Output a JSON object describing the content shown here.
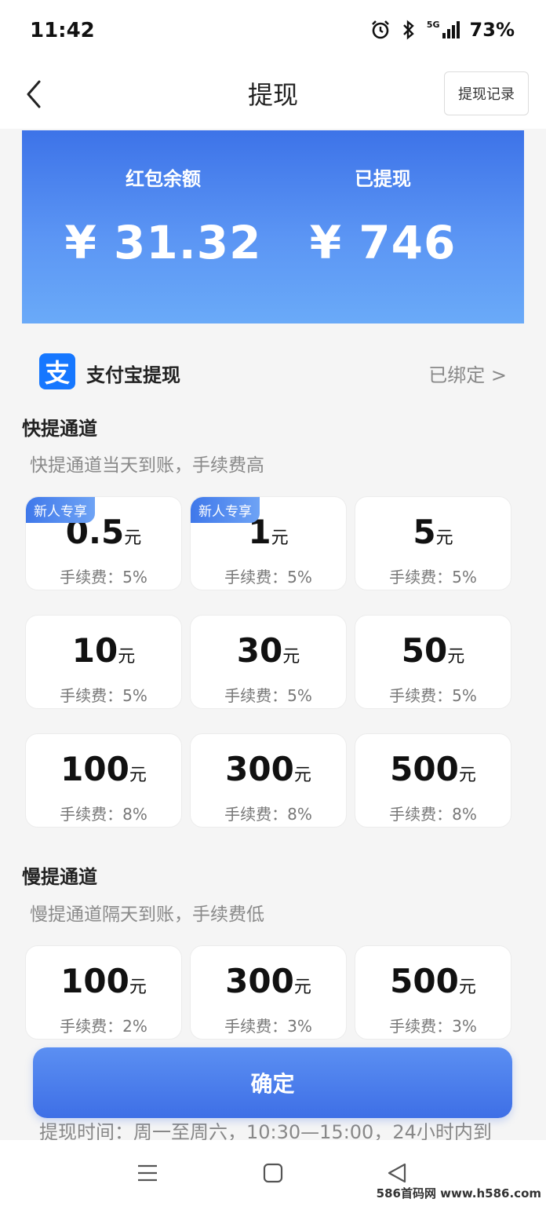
{
  "status_bar": {
    "time": "11:42",
    "network": "5G",
    "battery": "73%"
  },
  "header": {
    "title": "提现",
    "record_button": "提现记录"
  },
  "balance": {
    "left_label": "红包余额",
    "left_value": "¥ 31.32",
    "right_label": "已提现",
    "right_value": "¥ 746"
  },
  "alipay": {
    "icon_char": "支",
    "label": "支付宝提现",
    "bound": "已绑定 >"
  },
  "fast": {
    "title": "快提通道",
    "subtitle": "快提通道当天到账，手续费高",
    "cards": [
      {
        "amount": "0.5",
        "unit": "元",
        "fee": "手续费：5%",
        "badge": "新人专享"
      },
      {
        "amount": "1",
        "unit": "元",
        "fee": "手续费：5%",
        "badge": "新人专享"
      },
      {
        "amount": "5",
        "unit": "元",
        "fee": "手续费：5%"
      },
      {
        "amount": "10",
        "unit": "元",
        "fee": "手续费：5%"
      },
      {
        "amount": "30",
        "unit": "元",
        "fee": "手续费：5%"
      },
      {
        "amount": "50",
        "unit": "元",
        "fee": "手续费：5%"
      },
      {
        "amount": "100",
        "unit": "元",
        "fee": "手续费：8%"
      },
      {
        "amount": "300",
        "unit": "元",
        "fee": "手续费：8%"
      },
      {
        "amount": "500",
        "unit": "元",
        "fee": "手续费：8%"
      }
    ]
  },
  "slow": {
    "title": "慢提通道",
    "subtitle": "慢提通道隔天到账，手续费低",
    "cards": [
      {
        "amount": "100",
        "unit": "元",
        "fee": "手续费：2%"
      },
      {
        "amount": "300",
        "unit": "元",
        "fee": "手续费：3%"
      },
      {
        "amount": "500",
        "unit": "元",
        "fee": "手续费：3%"
      }
    ]
  },
  "confirm": "确定",
  "time_note": "提现时间：周一至周六，10:30—15:00，24小时内到",
  "watermark": "586首码网 www.h586.com",
  "colors": {
    "accent": "#3e6fe6",
    "banner_top": "#3d73e8",
    "banner_bottom": "#6aaaf8",
    "alipay": "#1677ff"
  },
  "icons": [
    "alarm-icon",
    "bluetooth-icon",
    "signal-icon",
    "back-arrow-icon",
    "menu-icon",
    "home-icon",
    "back-triangle-icon"
  ]
}
